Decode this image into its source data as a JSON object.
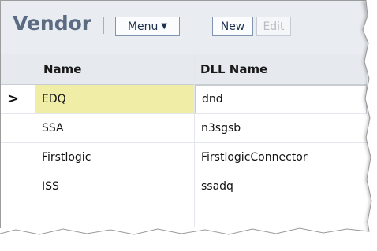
{
  "toolbar": {
    "title": "Vendor",
    "menu_label": "Menu",
    "new_label": "New",
    "edit_label": "Edit"
  },
  "grid": {
    "columns": [
      "Name",
      "DLL Name"
    ],
    "rows": [
      {
        "name": "EDQ",
        "dll": "dnd",
        "selected": true
      },
      {
        "name": "SSA",
        "dll": "n3sgsb",
        "selected": false
      },
      {
        "name": "Firstlogic",
        "dll": "FirstlogicConnector",
        "selected": false
      },
      {
        "name": "ISS",
        "dll": "ssadq",
        "selected": false
      }
    ],
    "selected_indicator": "›",
    "selection_color": "#efeda6"
  }
}
